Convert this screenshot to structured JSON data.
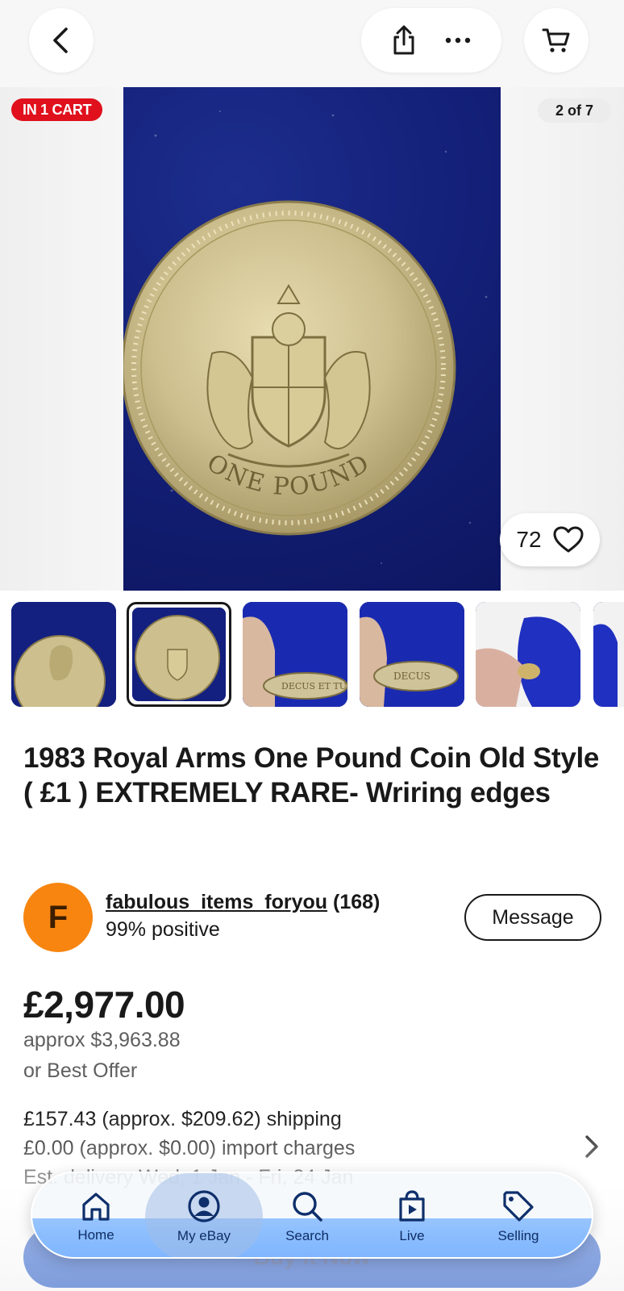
{
  "image_badge": "IN 1 CART",
  "image_counter": "2 of 7",
  "watch_count": "72",
  "title": "1983 Royal Arms One Pound Coin Old Style ( £1 )   EXTREMELY RARE- Wriring edges",
  "seller": {
    "initial": "F",
    "username": "fabulous_items_foryou",
    "feedback_count": "(168)",
    "positive": "99% positive",
    "message_label": "Message"
  },
  "price": {
    "amount": "£2,977.00",
    "approx": "approx $3,963.88",
    "offer": "or Best Offer"
  },
  "shipping": {
    "line1": "£157.43 (approx. $209.62) shipping",
    "line2": "£0.00 (approx. $0.00) import charges",
    "line3": "Est. delivery Wed, 1 Jan - Fri, 24 Jan"
  },
  "buy_label": "Buy It Now",
  "coin_text": {
    "reverse": "ONE POUND",
    "edge1": "DECUS ET TUTAMEN",
    "edge2": "DECUS"
  },
  "nav": {
    "items": [
      {
        "label": "Home",
        "icon": "home-icon"
      },
      {
        "label": "My eBay",
        "icon": "user-icon"
      },
      {
        "label": "Search",
        "icon": "search-icon"
      },
      {
        "label": "Live",
        "icon": "live-bag-icon"
      },
      {
        "label": "Selling",
        "icon": "tag-icon"
      }
    ],
    "active": "My eBay"
  },
  "colors": {
    "badge_red": "#e0101c",
    "avatar_orange": "#f7850f",
    "buy_blue": "#0d48c6",
    "nav_blue": "#86bbff"
  }
}
